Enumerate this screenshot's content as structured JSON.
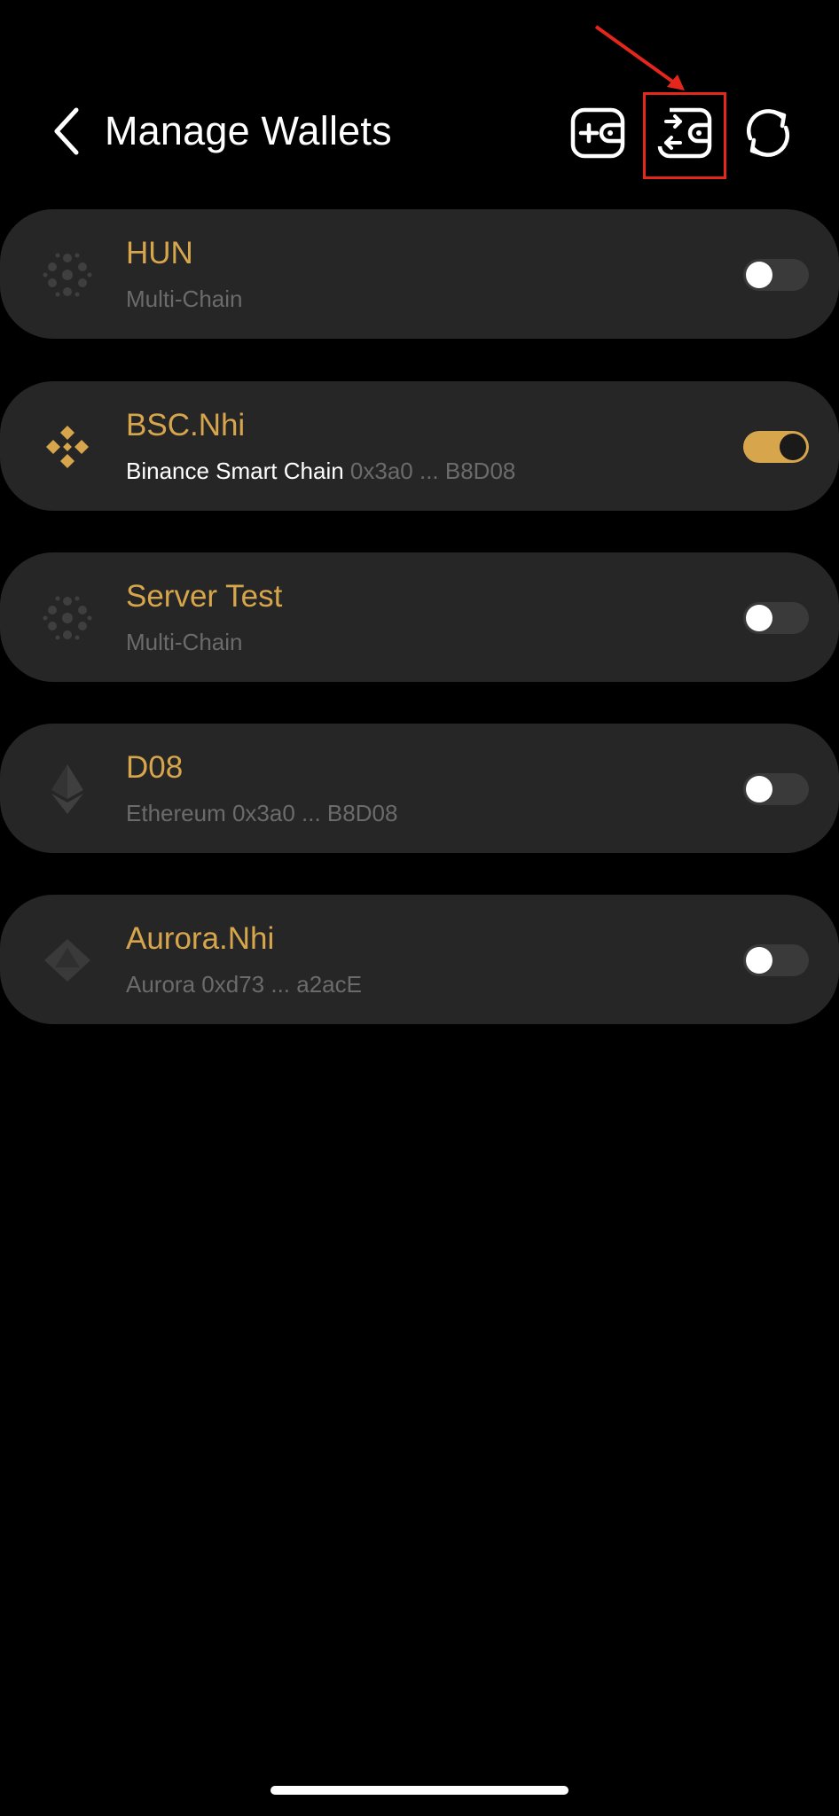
{
  "header": {
    "title": "Manage Wallets",
    "icons": {
      "back": "chevron-left-icon",
      "add_wallet": "add-wallet-icon",
      "switch_wallet": "switch-wallet-icon",
      "sync": "sync-icon"
    }
  },
  "colors": {
    "background": "#000000",
    "card": "#262626",
    "accent": "#d7a64c",
    "muted": "#6b6b6b",
    "highlight": "#e4261c"
  },
  "wallets": [
    {
      "name": "HUN",
      "chain": "Multi-Chain",
      "address": "",
      "icon": "multi-chain-dots-icon",
      "enabled": false
    },
    {
      "name": "BSC.Nhi",
      "chain": "Binance Smart Chain",
      "address": "0x3a0 ... B8D08",
      "icon": "binance-icon",
      "enabled": true
    },
    {
      "name": "Server Test",
      "chain": "Multi-Chain",
      "address": "",
      "icon": "multi-chain-dots-icon",
      "enabled": false
    },
    {
      "name": "D08",
      "chain": "Ethereum",
      "address": "0x3a0 ... B8D08",
      "icon": "ethereum-icon",
      "enabled": false
    },
    {
      "name": "Aurora.Nhi",
      "chain": "Aurora",
      "address": "0xd73 ... a2acE",
      "icon": "aurora-icon",
      "enabled": false
    }
  ]
}
